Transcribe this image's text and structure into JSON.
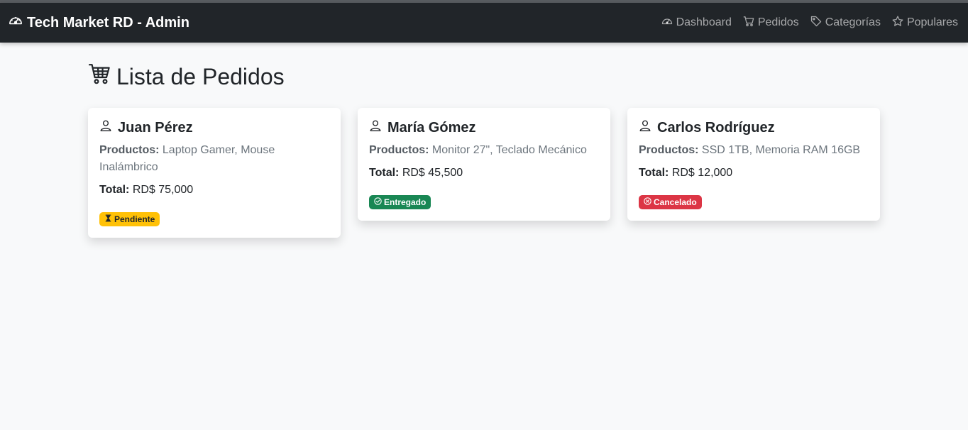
{
  "navbar": {
    "brand": "Tech Market RD - Admin",
    "brand_icon": "speedometer-icon",
    "links": [
      {
        "label": "Dashboard",
        "icon": "speedometer-icon"
      },
      {
        "label": "Pedidos",
        "icon": "cart-icon"
      },
      {
        "label": "Categorías",
        "icon": "tag-icon"
      },
      {
        "label": "Populares",
        "icon": "star-icon"
      }
    ]
  },
  "page": {
    "title": "Lista de Pedidos",
    "title_icon": "cart-icon"
  },
  "orders": [
    {
      "customer": "Juan Pérez",
      "products_label": "Productos:",
      "products": "Laptop Gamer, Mouse Inalámbrico",
      "total_label": "Total:",
      "total": "RD$ 75,000",
      "status": "Pendiente",
      "status_icon": "hourglass-icon",
      "status_color": "#ffc107"
    },
    {
      "customer": "María Gómez",
      "products_label": "Productos:",
      "products": "Monitor 27\", Teclado Mecánico",
      "total_label": "Total:",
      "total": "RD$ 45,500",
      "status": "Entregado",
      "status_icon": "check-circle-icon",
      "status_color": "#198754"
    },
    {
      "customer": "Carlos Rodríguez",
      "products_label": "Productos:",
      "products": "SSD 1TB, Memoria RAM 16GB",
      "total_label": "Total:",
      "total": "RD$ 12,000",
      "status": "Cancelado",
      "status_icon": "x-circle-icon",
      "status_color": "#dc3545"
    }
  ]
}
